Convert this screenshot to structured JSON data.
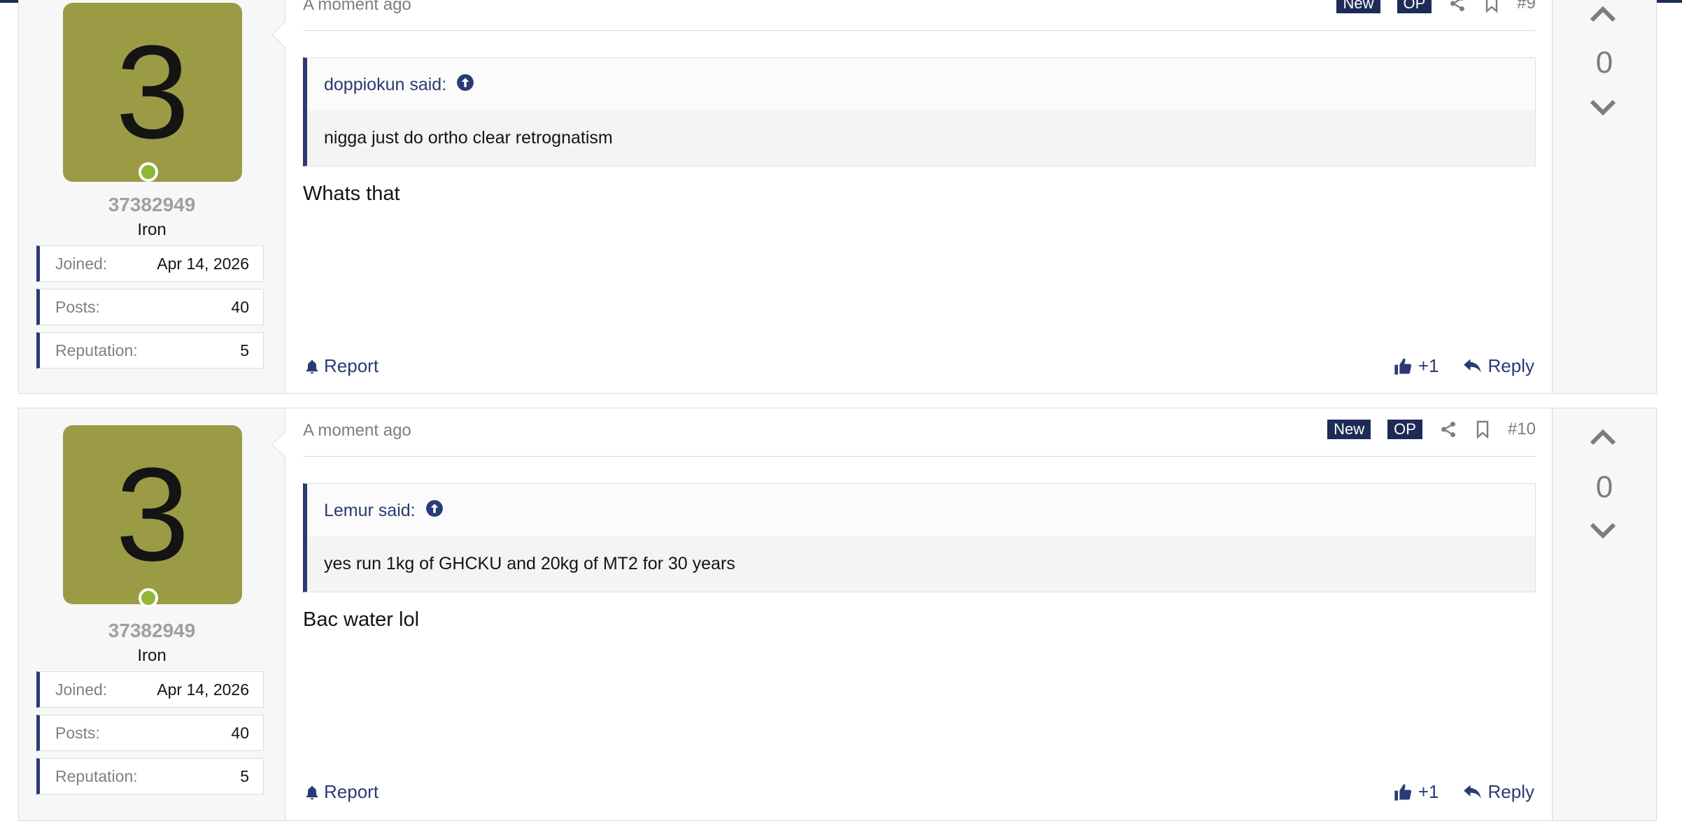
{
  "posts": [
    {
      "user": {
        "avatar_letter": "3",
        "avatar_color": "#9b9b45",
        "username": "37382949",
        "rank": "Iron",
        "stats": [
          {
            "label": "Joined:",
            "value": "Apr 14, 2026"
          },
          {
            "label": "Posts:",
            "value": "40"
          },
          {
            "label": "Reputation:",
            "value": "5"
          }
        ]
      },
      "time": "A moment ago",
      "tag_new": "New",
      "tag_op": "OP",
      "post_number": "#9",
      "quote": {
        "author": "doppiokun said:",
        "text": "nigga just do ortho clear retrognatism"
      },
      "message": "Whats that",
      "report_label": "Report",
      "like_label": "+1",
      "reply_label": "Reply",
      "score": "0"
    },
    {
      "user": {
        "avatar_letter": "3",
        "avatar_color": "#9b9b45",
        "username": "37382949",
        "rank": "Iron",
        "stats": [
          {
            "label": "Joined:",
            "value": "Apr 14, 2026"
          },
          {
            "label": "Posts:",
            "value": "40"
          },
          {
            "label": "Reputation:",
            "value": "5"
          }
        ]
      },
      "time": "A moment ago",
      "tag_new": "New",
      "tag_op": "OP",
      "post_number": "#10",
      "quote": {
        "author": "Lemur said:",
        "text": "yes run 1kg of GHCKU and 20kg of MT2 for 30 years"
      },
      "message": "Bac water lol",
      "report_label": "Report",
      "like_label": "+1",
      "reply_label": "Reply",
      "score": "0"
    }
  ],
  "colors": {
    "accent": "#2a3a74",
    "online": "#8fb63a",
    "tag_bg": "#1d2b56"
  },
  "icons": [
    "share-icon",
    "bookmark-icon",
    "arrow-circle-up-icon",
    "bell-icon",
    "thumbs-up-icon",
    "reply-arrow-icon",
    "chevron-up-icon",
    "chevron-down-icon"
  ]
}
